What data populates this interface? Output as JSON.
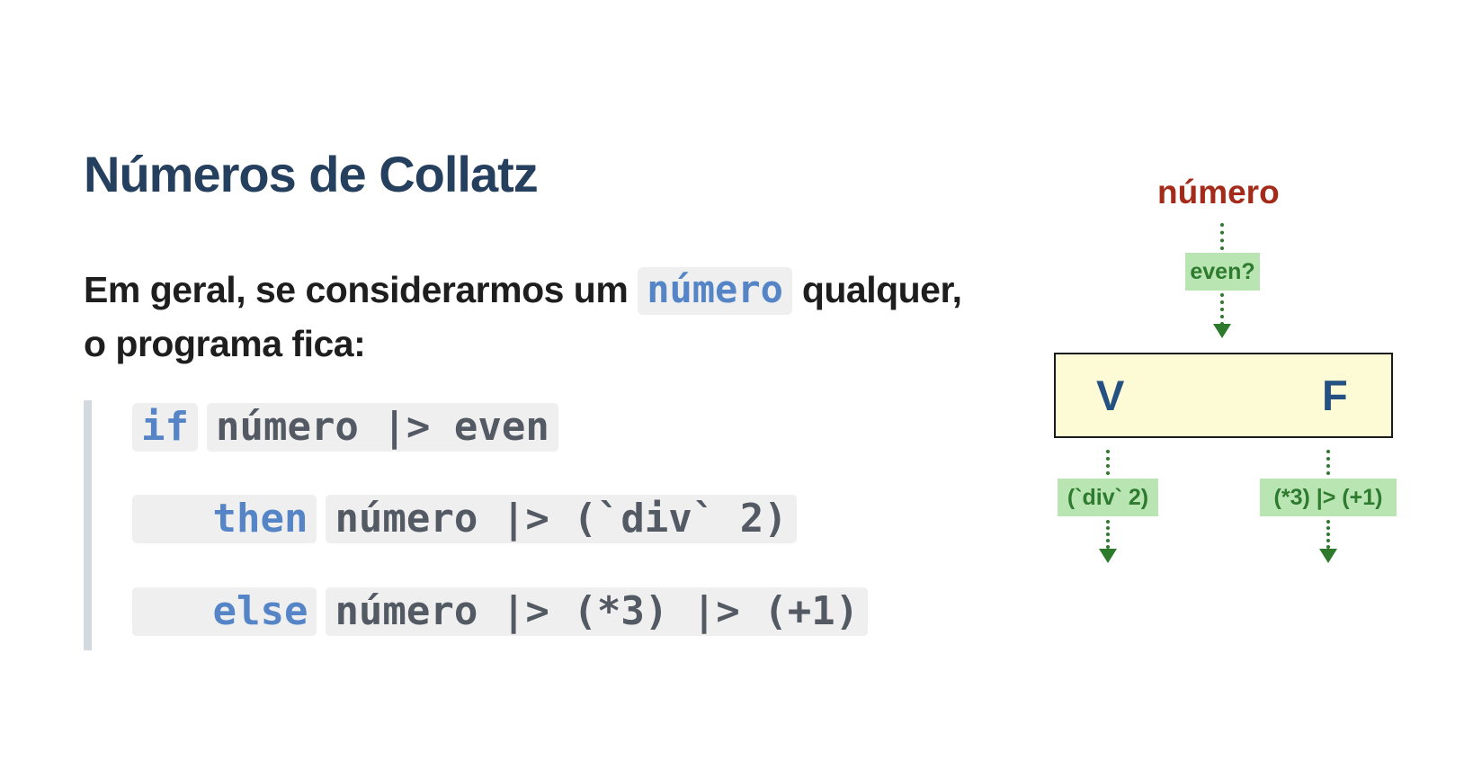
{
  "slide": {
    "title": "Números de Collatz",
    "intro_text_before": "Em geral, se considerarmos um ",
    "intro_code": "número",
    "intro_text_after": " qualquer, o programa fica:"
  },
  "code": {
    "lines": [
      {
        "keyword": "if",
        "expression": "número |> even"
      },
      {
        "keyword": "   then",
        "expression": "número |> (`div` 2)"
      },
      {
        "keyword": "   else",
        "expression": "número |> (*3) |> (+1)"
      }
    ]
  },
  "diagram": {
    "input_label": "número",
    "condition": "even?",
    "true_label": "V",
    "false_label": "F",
    "true_action": "(`div` 2)",
    "false_action": "(*3) |> (+1)"
  },
  "colors": {
    "title": "#253f5f",
    "keyword": "#5585c6",
    "expression": "#545a63",
    "diagram_input": "#a42a1a",
    "diagram_tag_bg": "#b9e5b3",
    "diagram_tag_text": "#2e7a2e",
    "decision_box_bg": "#fdfbd6",
    "branch_letter": "#245182"
  }
}
